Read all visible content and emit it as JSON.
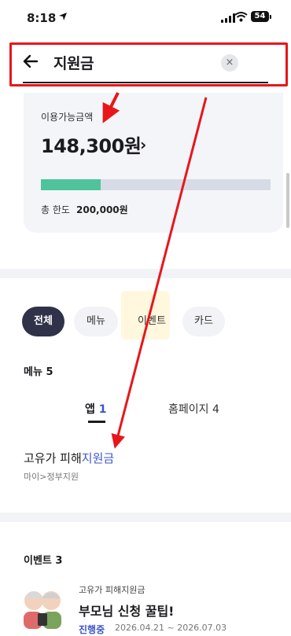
{
  "status": {
    "time": "8:18",
    "battery": "54"
  },
  "search": {
    "query": "지원금",
    "clear": "×"
  },
  "balance": {
    "label": "이용가능금액",
    "amount": "148,300원",
    "chevron": "›",
    "progress_fraction": 0.26,
    "limit_label": "총 한도",
    "limit_value": "200,000원"
  },
  "filters": [
    "전체",
    "메뉴",
    "이벤트",
    "카드"
  ],
  "menu_section": {
    "title": "메뉴",
    "count": "5",
    "tabs": [
      {
        "label": "앱",
        "count": "1"
      },
      {
        "label": "홈페이지",
        "count": "4"
      }
    ]
  },
  "result": {
    "title_prefix": "고유가 피해",
    "title_highlight": "지원금",
    "path": "마이>정부지원"
  },
  "event_section": {
    "title": "이벤트",
    "count": "3"
  },
  "event": {
    "small": "고유가 피해지원금",
    "title": "부모님 신청 꿀팁!",
    "status": "진행중",
    "dates": "2026.04.21 ~ 2026.07.03"
  },
  "colors": {
    "accent": "#3a56c8",
    "progress": "#4fc39b",
    "annotation": "#e8161b",
    "chip_active": "#2f3249"
  }
}
